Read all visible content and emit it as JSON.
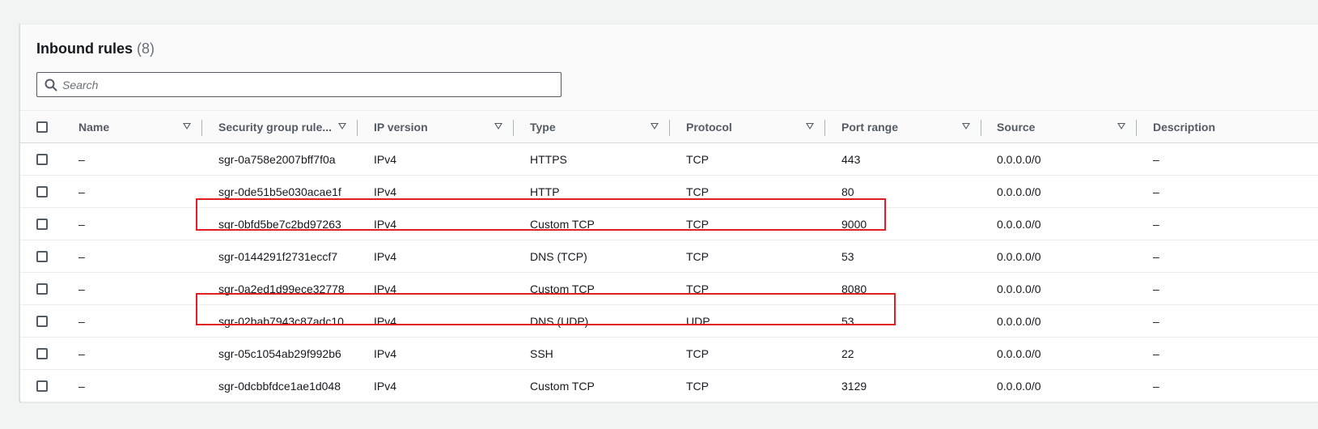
{
  "header": {
    "title": "Inbound rules",
    "count": "(8)"
  },
  "search": {
    "placeholder": "Search",
    "value": ""
  },
  "columns": {
    "name": "Name",
    "rule_id": "Security group rule...",
    "ip_version": "IP version",
    "type": "Type",
    "protocol": "Protocol",
    "port_range": "Port range",
    "source": "Source",
    "description": "Description"
  },
  "rows": [
    {
      "name": "–",
      "rule_id": "sgr-0a758e2007bff7f0a",
      "ip_version": "IPv4",
      "type": "HTTPS",
      "protocol": "TCP",
      "port_range": "443",
      "source": "0.0.0.0/0",
      "description": "–"
    },
    {
      "name": "–",
      "rule_id": "sgr-0de51b5e030acae1f",
      "ip_version": "IPv4",
      "type": "HTTP",
      "protocol": "TCP",
      "port_range": "80",
      "source": "0.0.0.0/0",
      "description": "–"
    },
    {
      "name": "–",
      "rule_id": "sgr-0bfd5be7c2bd97263",
      "ip_version": "IPv4",
      "type": "Custom TCP",
      "protocol": "TCP",
      "port_range": "9000",
      "source": "0.0.0.0/0",
      "description": "–"
    },
    {
      "name": "–",
      "rule_id": "sgr-0144291f2731eccf7",
      "ip_version": "IPv4",
      "type": "DNS (TCP)",
      "protocol": "TCP",
      "port_range": "53",
      "source": "0.0.0.0/0",
      "description": "–"
    },
    {
      "name": "–",
      "rule_id": "sgr-0a2ed1d99ece32778",
      "ip_version": "IPv4",
      "type": "Custom TCP",
      "protocol": "TCP",
      "port_range": "8080",
      "source": "0.0.0.0/0",
      "description": "–"
    },
    {
      "name": "–",
      "rule_id": "sgr-02bab7943c87adc10",
      "ip_version": "IPv4",
      "type": "DNS (UDP)",
      "protocol": "UDP",
      "port_range": "53",
      "source": "0.0.0.0/0",
      "description": "–"
    },
    {
      "name": "–",
      "rule_id": "sgr-05c1054ab29f992b6",
      "ip_version": "IPv4",
      "type": "SSH",
      "protocol": "TCP",
      "port_range": "22",
      "source": "0.0.0.0/0",
      "description": "–"
    },
    {
      "name": "–",
      "rule_id": "sgr-0dcbbfdce1ae1d048",
      "ip_version": "IPv4",
      "type": "Custom TCP",
      "protocol": "TCP",
      "port_range": "3129",
      "source": "0.0.0.0/0",
      "description": "–"
    }
  ],
  "colors": {
    "highlight": "#e02020",
    "border": "#545b64"
  },
  "icons": {
    "search": "search-icon",
    "sort": "caret-down-icon",
    "checkbox": "checkbox-icon"
  }
}
